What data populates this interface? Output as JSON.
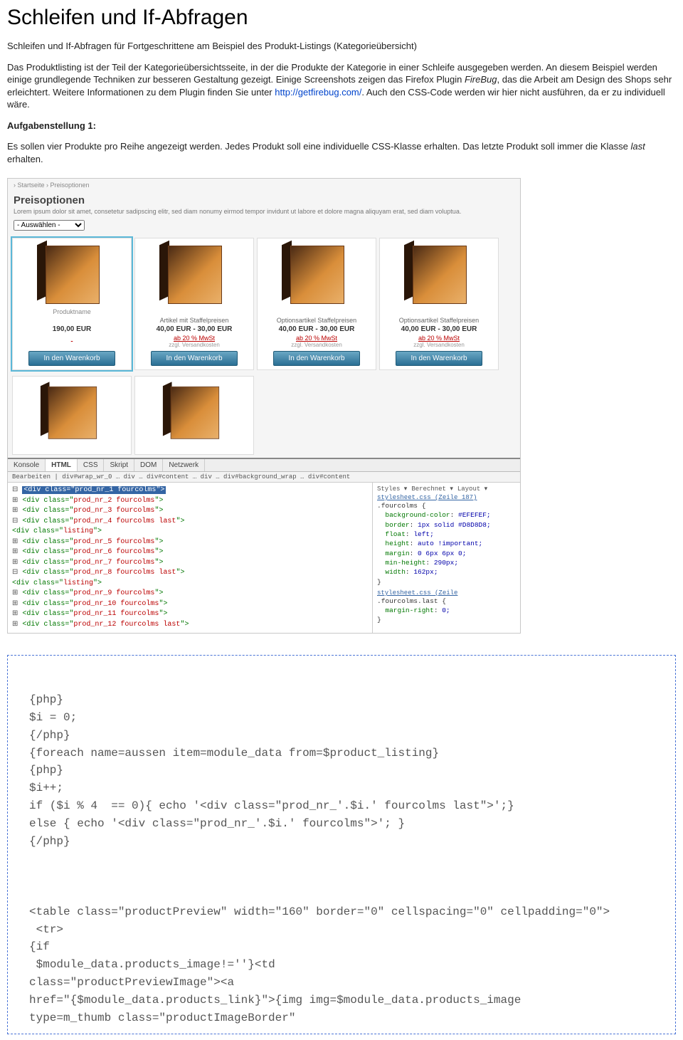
{
  "title": "Schleifen und If-Abfragen",
  "intro_line": "Schleifen und If-Abfragen für Fortgeschrittene am Beispiel des Produkt-Listings (Kategorieübersicht)",
  "paragraph": {
    "p1": "Das Produktlisting ist der Teil der Kategorieübersichtsseite, in der die Produkte der Kategorie in einer Schleife ausgegeben werden. An diesem Beispiel werden einige grundlegende Techniken zur besseren Gestaltung gezeigt. Einige Screenshots zeigen das Firefox Plugin ",
    "firebug_name": "FireBug",
    "p2": ", das die Arbeit am Design des Shops sehr erleichtert. Weitere Informationen zu dem Plugin finden Sie unter ",
    "link_text": "http://getfirebug.com/",
    "p3": ". Auch den CSS-Code werden wir hier nicht ausführen, da er zu individuell wäre."
  },
  "task_label": "Aufgabenstellung 1:",
  "task_text_1": "Es sollen vier Produkte pro Reihe angezeigt werden. Jedes Produkt soll eine individuelle CSS-Klasse erhalten. Das letzte Produkt soll immer die Klasse ",
  "task_last_class": "last",
  "task_text_2": " erhalten.",
  "screenshot": {
    "breadcrumb": "› Startseite › Preisoptionen",
    "heading": "Preisoptionen",
    "lorem": "Lorem ipsum dolor sit amet, consetetur sadipscing elitr, sed diam nonumy eirmod tempor invidunt ut labore et dolore magna aliquyam erat, sed diam voluptua.",
    "select": "- Auswählen -",
    "products": [
      {
        "title": "Produktname",
        "name": "",
        "price": "190,00 EUR",
        "save": "",
        "info": "",
        "btn": "In den Warenkorb"
      },
      {
        "title": "",
        "name": "Artikel mit Staffelpreisen",
        "price": "40,00 EUR - 30,00 EUR",
        "save": "ab 20 % MwSt",
        "info": "zzgl. Versandkosten",
        "btn": "In den Warenkorb"
      },
      {
        "title": "",
        "name": "Optionsartikel Staffelpreisen",
        "price": "40,00 EUR - 30,00 EUR",
        "save": "ab 20 % MwSt",
        "info": "zzgl. Versandkosten",
        "btn": "In den Warenkorb"
      },
      {
        "title": "",
        "name": "Optionsartikel Staffelpreisen",
        "price": "40,00 EUR - 30,00 EUR",
        "save": "ab 20 % MwSt",
        "info": "zzgl. Versandkosten",
        "btn": "In den Warenkorb"
      }
    ],
    "firebug": {
      "tabs": [
        "Konsole",
        "HTML",
        "CSS",
        "Skript",
        "DOM",
        "Netzwerk"
      ],
      "active_tab": "HTML",
      "crumb": "Bearbeiten | div#wrap_wr_0 … div … div#content … div … div#background_wrap … div#content",
      "left_lines": [
        {
          "pfx": "⊟",
          "html": "<div class=\"prod_nr_1 fourcolms\">",
          "hl": true
        },
        {
          "pfx": "⊞",
          "html": "<div class=\"prod_nr_2 fourcolms\">"
        },
        {
          "pfx": "⊞",
          "html": "<div class=\"prod_nr_3 fourcolms\">"
        },
        {
          "pfx": "⊟",
          "html": "<div class=\"prod_nr_4 fourcolms last\">"
        },
        {
          "pfx": "  ",
          "html": "  <div class=\"listing\">"
        },
        {
          "pfx": "⊞",
          "html": "<div class=\"prod_nr_5 fourcolms\">"
        },
        {
          "pfx": "⊞",
          "html": "<div class=\"prod_nr_6 fourcolms\">"
        },
        {
          "pfx": "⊞",
          "html": "<div class=\"prod_nr_7 fourcolms\">"
        },
        {
          "pfx": "⊟",
          "html": "<div class=\"prod_nr_8 fourcolms last\">"
        },
        {
          "pfx": "  ",
          "html": "  <div class=\"listing\">"
        },
        {
          "pfx": "⊞",
          "html": "<div class=\"prod_nr_9 fourcolms\">"
        },
        {
          "pfx": "⊞",
          "html": "<div class=\"prod_nr_10 fourcolms\">"
        },
        {
          "pfx": "⊞",
          "html": "<div class=\"prod_nr_11 fourcolms\">"
        },
        {
          "pfx": "⊞",
          "html": "<div class=\"prod_nr_12 fourcolms last\">"
        }
      ],
      "right": {
        "tabs": [
          "Styles",
          "Berechnet",
          "Layout"
        ],
        "file1": "stylesheet.css (Zeile 187)",
        "selector1": ".fourcolms {",
        "rules1": [
          "background-color: #EFEFEF;",
          "border: 1px solid #D8D8D8;",
          "float: left;",
          "height: auto !important;",
          "margin: 0 6px 6px 0;",
          "min-height: 290px;",
          "width: 162px;"
        ],
        "close1": "}",
        "file2": "stylesheet.css (Zeile",
        "selector2": ".fourcolms.last {",
        "rules2": [
          "margin-right: 0;"
        ],
        "close2": "}"
      }
    }
  },
  "code": "{php}\n$i = 0;\n{/php}\n{foreach name=aussen item=module_data from=$product_listing}\n{php}\n$i++;\nif ($i % 4  == 0){ echo '<div class=\"prod_nr_'.$i.' fourcolms last\">';}\nelse { echo '<div class=\"prod_nr_'.$i.' fourcolms\">'; }\n{/php}\n\n\n\n<table class=\"productPreview\" width=\"160\" border=\"0\" cellspacing=\"0\" cellpadding=\"0\">\n <tr>\n{if\n $module_data.products_image!=''}<td\nclass=\"productPreviewImage\"><a\nhref=\"{$module_data.products_link}\">{img img=$module_data.products_image\ntype=m_thumb class=\"productImageBorder\""
}
